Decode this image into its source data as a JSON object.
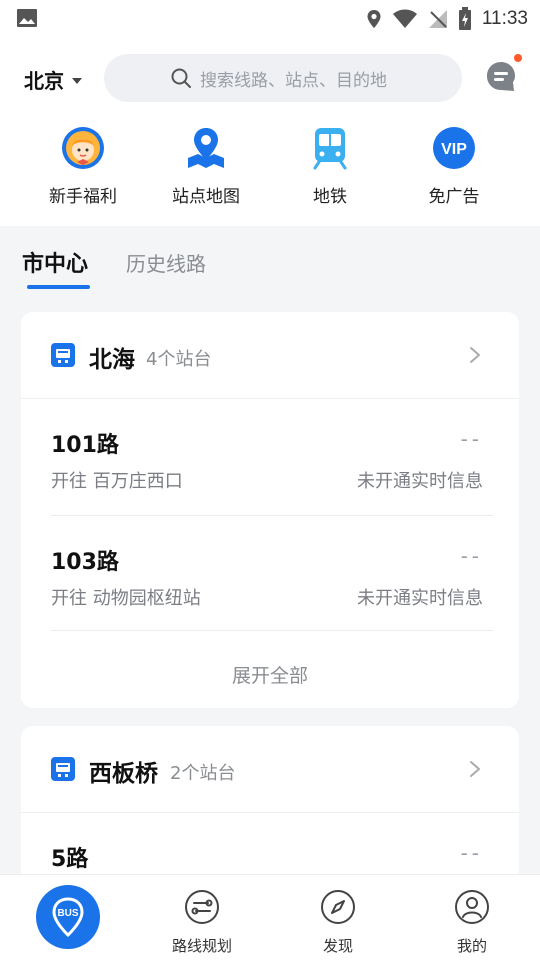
{
  "status_bar": {
    "time": "11:33"
  },
  "header": {
    "city": "北京",
    "search_placeholder": "搜索线路、站点、目的地"
  },
  "quick_actions": [
    {
      "label": "新手福利",
      "icon": "gift-avatar-icon"
    },
    {
      "label": "站点地图",
      "icon": "map-pin-icon"
    },
    {
      "label": "地铁",
      "icon": "subway-train-icon"
    },
    {
      "label": "免广告",
      "icon": "vip-icon",
      "badge": "VIP"
    }
  ],
  "tabs": {
    "active": "市中心",
    "inactive": "历史线路"
  },
  "cards": [
    {
      "stop_name": "北海",
      "stop_count": "4个站台",
      "routes": [
        {
          "name": "101路",
          "direction": "开往 百万庄西口",
          "eta": "--",
          "status": "未开通实时信息"
        },
        {
          "name": "103路",
          "direction": "开往 动物园枢纽站",
          "eta": "--",
          "status": "未开通实时信息"
        }
      ],
      "expand_label": "展开全部"
    },
    {
      "stop_name": "西板桥",
      "stop_count": "2个站台",
      "routes": [
        {
          "name": "5路",
          "eta": "--"
        }
      ]
    }
  ],
  "bottom_nav": {
    "bus_label": "BUS",
    "items": [
      {
        "label": "路线规划",
        "icon": "route-plan-icon"
      },
      {
        "label": "发现",
        "icon": "compass-icon"
      },
      {
        "label": "我的",
        "icon": "profile-icon"
      }
    ]
  },
  "colors": {
    "accent": "#1a73e8",
    "notification": "#ff5a2a",
    "background": "#f4f5f7"
  }
}
